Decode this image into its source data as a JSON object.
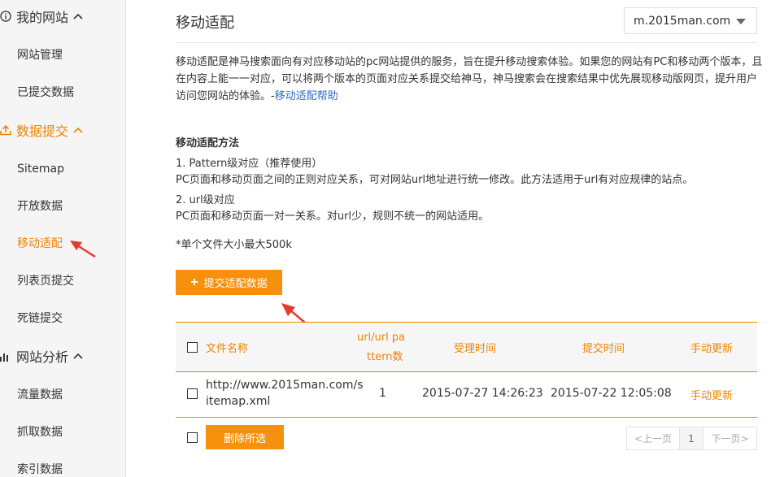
{
  "sidebar": {
    "sections": [
      {
        "title": "我的网站",
        "icon": "info-icon",
        "items": [
          "网站管理",
          "已提交数据"
        ]
      },
      {
        "title": "数据提交",
        "icon": "upload-icon",
        "items": [
          "Sitemap",
          "开放数据",
          "移动适配",
          "列表页提交",
          "死链提交"
        ]
      },
      {
        "title": "网站分析",
        "icon": "bar-chart-icon",
        "items": [
          "流量数据",
          "抓取数据",
          "索引数据"
        ]
      }
    ],
    "active_item": "移动适配"
  },
  "main": {
    "title": "移动适配",
    "domain_select": "m.2015man.com",
    "intro": "移动适配是神马搜索面向有对应移动站的pc网站提供的服务，旨在提升移动搜索体验。如果您的网站有PC和移动两个版本，且在内容上能一一对应，可以将两个版本的页面对应关系提交给神马，神马搜索会在搜索结果中优先展现移动版网页，提升用户访问您网站的体验。-",
    "help_link": "移动适配帮助",
    "method_title": "移动适配方法",
    "method1_title": "1. Pattern级对应（推荐使用）",
    "method1_desc": "PC页面和移动页面之间的正则对应关系，可对网站url地址进行统一修改。此方法适用于url有对应规律的站点。",
    "method2_title": "2. url级对应",
    "method2_desc": "PC页面和移动页面一对一关系。对url少，规则不统一的网站适用。",
    "note": "*单个文件大小最大500k",
    "submit_button": "提交适配数据"
  },
  "table": {
    "headers": {
      "filename": "文件名称",
      "pattern_line1": "url/url pa",
      "pattern_line2": "ttern数",
      "accept_time": "受理时间",
      "submit_time": "提交时间",
      "manual_update": "手动更新"
    },
    "rows": [
      {
        "filename_line1": "http://www.2015man.com/s",
        "filename_line2": "itemap.xml",
        "count": "1",
        "accept_time": "2015-07-27 14:26:23",
        "submit_time": "2015-07-22 12:05:08",
        "manual_update": "手动更新"
      }
    ],
    "delete_button": "删除所选"
  },
  "pagination": {
    "prev": "<上一页",
    "current": "1",
    "next": "下一页>"
  },
  "colors": {
    "accent": "#f08300",
    "button": "#f7900d",
    "link": "#2f6dc9",
    "annotation_arrow": "#e8392b"
  }
}
